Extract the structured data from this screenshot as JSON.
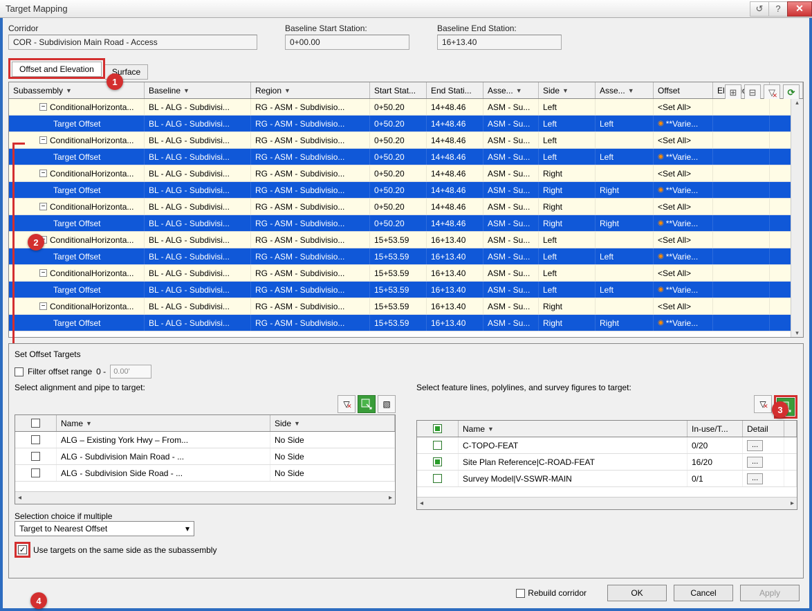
{
  "window_title": "Target Mapping",
  "fields": {
    "corridor_label": "Corridor",
    "corridor_value": "COR - Subdivision Main Road - Access",
    "bss_label": "Baseline Start Station:",
    "bss_value": "0+00.00",
    "bes_label": "Baseline End Station:",
    "bes_value": "16+13.40"
  },
  "tabs": {
    "active": "Offset and Elevation",
    "inactive": "Surface"
  },
  "grid_headers": {
    "sub": "Subassembly",
    "bl": "Baseline",
    "rg": "Region",
    "ss": "Start Stat...",
    "es": "End Stati...",
    "as": "Asse...",
    "sd": "Side",
    "as2": "Asse...",
    "off": "Offset",
    "elev": "Elevation"
  },
  "rows": [
    {
      "type": "p",
      "sub": "ConditionalHorizonta...",
      "bl": "BL - ALG - Subdivisi...",
      "rg": "RG - ASM - Subdivisio...",
      "ss": "0+50.20",
      "es": "14+48.46",
      "as": "ASM - Su...",
      "sd": "Left",
      "as2": "",
      "off": "<Set All>",
      "elev": ""
    },
    {
      "type": "c",
      "sub": "Target Offset",
      "bl": "BL - ALG - Subdivisi...",
      "rg": "RG - ASM - Subdivisio...",
      "ss": "0+50.20",
      "es": "14+48.46",
      "as": "ASM - Su...",
      "sd": "Left",
      "as2": "Left",
      "off": "**Varie...",
      "elev": ""
    },
    {
      "type": "p",
      "sub": "ConditionalHorizonta...",
      "bl": "BL - ALG - Subdivisi...",
      "rg": "RG - ASM - Subdivisio...",
      "ss": "0+50.20",
      "es": "14+48.46",
      "as": "ASM - Su...",
      "sd": "Left",
      "as2": "",
      "off": "<Set All>",
      "elev": ""
    },
    {
      "type": "c",
      "sub": "Target Offset",
      "bl": "BL - ALG - Subdivisi...",
      "rg": "RG - ASM - Subdivisio...",
      "ss": "0+50.20",
      "es": "14+48.46",
      "as": "ASM - Su...",
      "sd": "Left",
      "as2": "Left",
      "off": "**Varie...",
      "elev": ""
    },
    {
      "type": "p",
      "sub": "ConditionalHorizonta...",
      "bl": "BL - ALG - Subdivisi...",
      "rg": "RG - ASM - Subdivisio...",
      "ss": "0+50.20",
      "es": "14+48.46",
      "as": "ASM - Su...",
      "sd": "Right",
      "as2": "",
      "off": "<Set All>",
      "elev": ""
    },
    {
      "type": "c",
      "sub": "Target Offset",
      "bl": "BL - ALG - Subdivisi...",
      "rg": "RG - ASM - Subdivisio...",
      "ss": "0+50.20",
      "es": "14+48.46",
      "as": "ASM - Su...",
      "sd": "Right",
      "as2": "Right",
      "off": "**Varie...",
      "elev": ""
    },
    {
      "type": "p",
      "sub": "ConditionalHorizonta...",
      "bl": "BL - ALG - Subdivisi...",
      "rg": "RG - ASM - Subdivisio...",
      "ss": "0+50.20",
      "es": "14+48.46",
      "as": "ASM - Su...",
      "sd": "Right",
      "as2": "",
      "off": "<Set All>",
      "elev": ""
    },
    {
      "type": "c",
      "sub": "Target Offset",
      "bl": "BL - ALG - Subdivisi...",
      "rg": "RG - ASM - Subdivisio...",
      "ss": "0+50.20",
      "es": "14+48.46",
      "as": "ASM - Su...",
      "sd": "Right",
      "as2": "Right",
      "off": "**Varie...",
      "elev": ""
    },
    {
      "type": "p",
      "sub": "ConditionalHorizonta...",
      "bl": "BL - ALG - Subdivisi...",
      "rg": "RG - ASM - Subdivisio...",
      "ss": "15+53.59",
      "es": "16+13.40",
      "as": "ASM - Su...",
      "sd": "Left",
      "as2": "",
      "off": "<Set All>",
      "elev": ""
    },
    {
      "type": "c",
      "sub": "Target Offset",
      "bl": "BL - ALG - Subdivisi...",
      "rg": "RG - ASM - Subdivisio...",
      "ss": "15+53.59",
      "es": "16+13.40",
      "as": "ASM - Su...",
      "sd": "Left",
      "as2": "Left",
      "off": "**Varie...",
      "elev": ""
    },
    {
      "type": "p",
      "sub": "ConditionalHorizonta...",
      "bl": "BL - ALG - Subdivisi...",
      "rg": "RG - ASM - Subdivisio...",
      "ss": "15+53.59",
      "es": "16+13.40",
      "as": "ASM - Su...",
      "sd": "Left",
      "as2": "",
      "off": "<Set All>",
      "elev": ""
    },
    {
      "type": "c",
      "sub": "Target Offset",
      "bl": "BL - ALG - Subdivisi...",
      "rg": "RG - ASM - Subdivisio...",
      "ss": "15+53.59",
      "es": "16+13.40",
      "as": "ASM - Su...",
      "sd": "Left",
      "as2": "Left",
      "off": "**Varie...",
      "elev": ""
    },
    {
      "type": "p",
      "sub": "ConditionalHorizonta...",
      "bl": "BL - ALG - Subdivisi...",
      "rg": "RG - ASM - Subdivisio...",
      "ss": "15+53.59",
      "es": "16+13.40",
      "as": "ASM - Su...",
      "sd": "Right",
      "as2": "",
      "off": "<Set All>",
      "elev": ""
    },
    {
      "type": "c",
      "sub": "Target Offset",
      "bl": "BL - ALG - Subdivisi...",
      "rg": "RG - ASM - Subdivisio...",
      "ss": "15+53.59",
      "es": "16+13.40",
      "as": "ASM - Su...",
      "sd": "Right",
      "as2": "Right",
      "off": "**Varie...",
      "elev": ""
    }
  ],
  "lower": {
    "title": "Set Offset Targets",
    "filter_label": "Filter offset range",
    "filter_zero": "0 -",
    "filter_val": "0.00'",
    "left_hdr": "Select alignment and pipe to target:",
    "right_hdr": "Select feature lines, polylines, and survey figures to target:",
    "left_cols": {
      "name": "Name",
      "side": "Side"
    },
    "right_cols": {
      "name": "Name",
      "inuse": "In-use/T...",
      "detail": "Detail"
    },
    "left_rows": [
      {
        "name": "ALG – Existing York Hwy – From...",
        "side": "No Side"
      },
      {
        "name": "ALG - Subdivision Main Road - ...",
        "side": "No Side"
      },
      {
        "name": "ALG - Subdivision Side Road - ...",
        "side": "No Side"
      }
    ],
    "right_rows": [
      {
        "name": "C-TOPO-FEAT",
        "inuse": "0/20",
        "checked": false
      },
      {
        "name": "Site Plan Reference|C-ROAD-FEAT",
        "inuse": "16/20",
        "checked": true
      },
      {
        "name": "Survey Model|V-SSWR-MAIN",
        "inuse": "0/1",
        "checked": false
      }
    ],
    "selchoice_label": "Selection choice if multiple",
    "selchoice_value": "Target to Nearest Offset",
    "sameside_label": "Use targets on the same side as the subassembly"
  },
  "buttons": {
    "rebuild": "Rebuild corridor",
    "ok": "OK",
    "cancel": "Cancel",
    "apply": "Apply"
  },
  "detail_btn": "..."
}
